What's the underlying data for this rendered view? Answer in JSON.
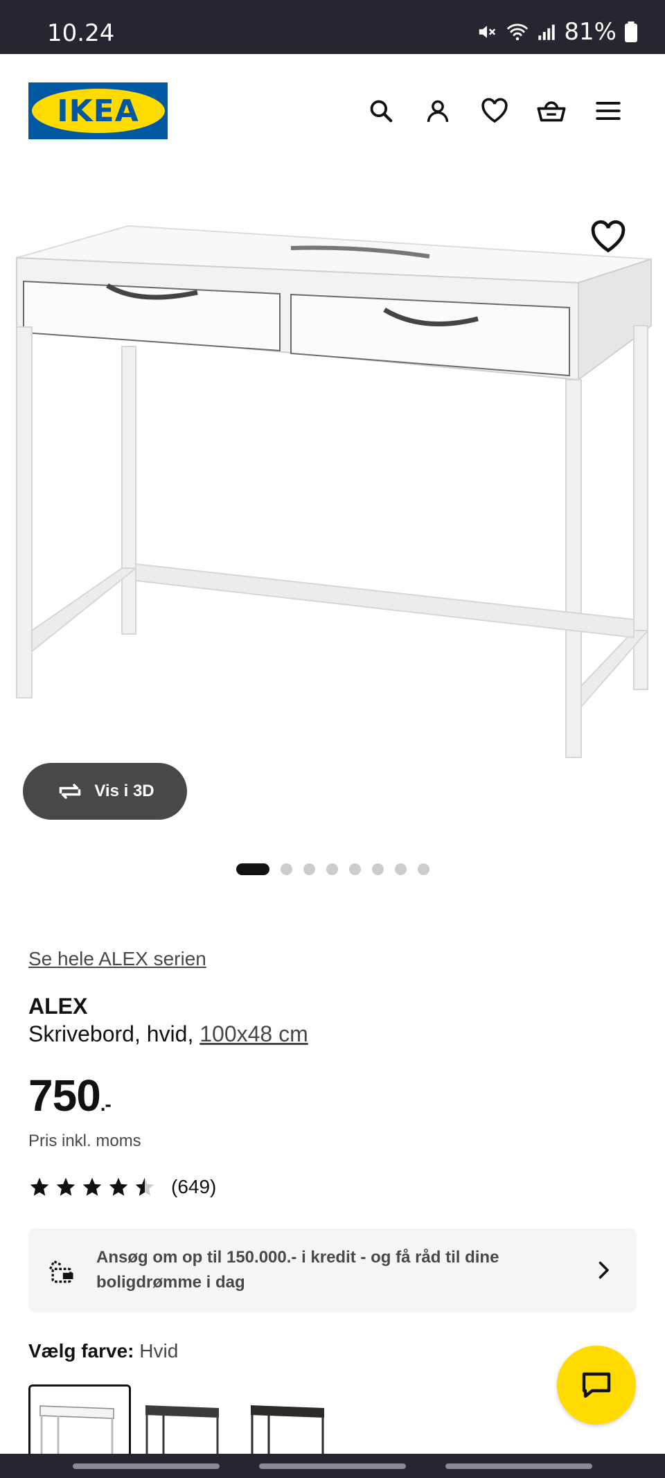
{
  "status_bar": {
    "time": "10.24",
    "battery": "81%"
  },
  "header": {
    "logo_text": "IKEA"
  },
  "gallery": {
    "view_3d_label": "Vis i 3D",
    "dot_count": 8,
    "active_index": 0
  },
  "product": {
    "series_link": "Se hele ALEX serien",
    "name": "ALEX",
    "description": "Skrivebord, hvid, ",
    "dimensions": "100x48 cm",
    "price": "750",
    "price_suffix": ".-",
    "price_note": "Pris inkl. moms",
    "rating": 4.5,
    "rating_count": "(649)"
  },
  "credit_banner": {
    "text": "Ansøg om op til 150.000.- i kredit - og få råd til dine boligdrømme i dag"
  },
  "color_select": {
    "label": "Vælg farve:",
    "value": "Hvid",
    "swatches": [
      {
        "name": "Hvid",
        "color": "#ffffff",
        "selected": true
      },
      {
        "name": "Sort",
        "color": "#3a3a3a",
        "selected": false
      },
      {
        "name": "Sortbrun",
        "color": "#2f2a28",
        "selected": false
      }
    ]
  },
  "colors": {
    "brand_blue": "#0058a3",
    "brand_yellow": "#ffdb00",
    "status_bar": "#262630"
  }
}
